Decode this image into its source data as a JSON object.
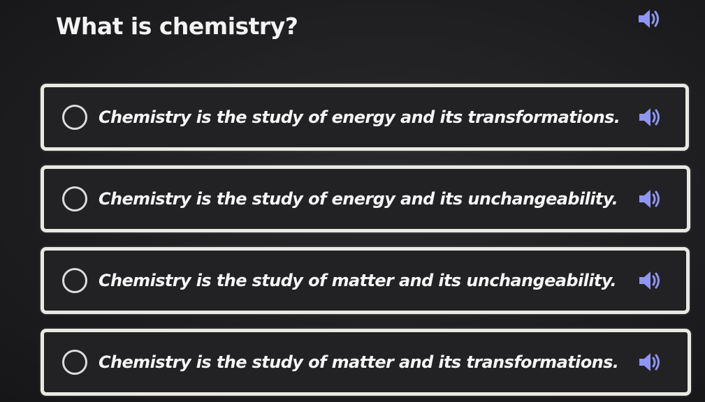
{
  "question": {
    "text": "What is chemistry?",
    "speaker_icon": "speaker-icon"
  },
  "options": [
    {
      "text": "Chemistry is the study of energy and its transformations.",
      "selected": false,
      "speaker_icon": "speaker-icon"
    },
    {
      "text": "Chemistry is the study of energy and its unchangeability.",
      "selected": false,
      "speaker_icon": "speaker-icon"
    },
    {
      "text": "Chemistry is the study of matter and its unchangeability.",
      "selected": false,
      "speaker_icon": "speaker-icon"
    },
    {
      "text": "Chemistry is the study of matter and its transformations.",
      "selected": false,
      "speaker_icon": "speaker-icon"
    }
  ],
  "colors": {
    "background": "#1f1f21",
    "option_border": "#e9e9e4",
    "speaker_blue": "#8f95f2",
    "text": "#f4f4f4"
  }
}
